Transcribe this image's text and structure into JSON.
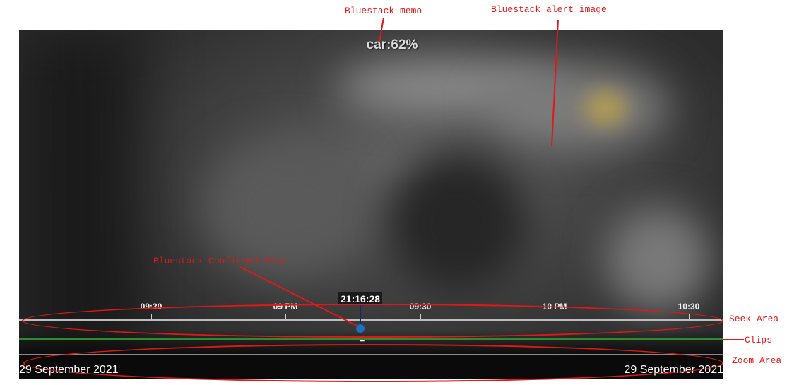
{
  "video": {
    "memo": "car:62%"
  },
  "timeline": {
    "cursor_time": "21:16:28",
    "ticks": [
      "09:30",
      "09 PM",
      "09:30",
      "10 PM",
      "10:30"
    ],
    "date_left": "29 September 2021",
    "date_right": "29 September 2021",
    "colors": {
      "clips": "#2e8b2e",
      "alert_dot": "#1e6fbf",
      "cursor_line": "#1a237e"
    }
  },
  "annotations": {
    "memo": "Bluestack memo",
    "alert_image": "Bluestack alert image",
    "confirmed_alert": "Bluestack Confirmed Alert",
    "seek_area": "Seek Area",
    "clips": "Clips",
    "zoom_area": "Zoom Area",
    "color": "#e01818"
  },
  "icons": {
    "cursor": "hand-pointer-icon"
  }
}
